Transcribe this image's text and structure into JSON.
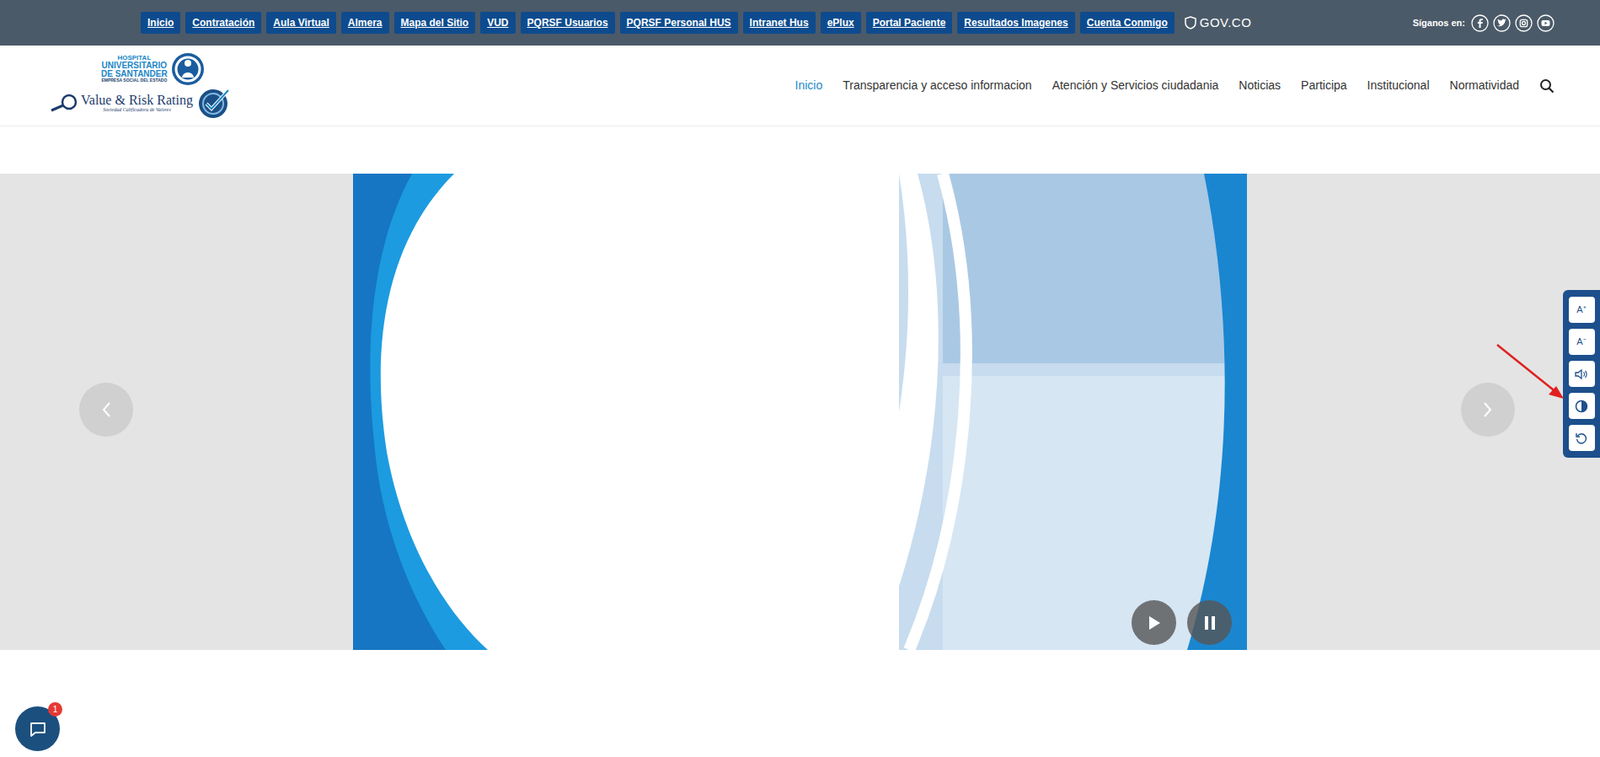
{
  "top_links": [
    "Inicio",
    "Contratación",
    "Aula Virtual",
    "Almera",
    "Mapa del Sitio",
    "VUD",
    "PQRSF Usuarios",
    "PQRSF Personal HUS",
    "Intranet Hus",
    "ePlux",
    "Portal Paciente",
    "Resultados Imagenes",
    "Cuenta Conmigo"
  ],
  "gov_logo": "GOV.CO",
  "social": {
    "label": "Síganos en:"
  },
  "logo": {
    "line1": "HOSPITAL",
    "line2": "UNIVERSITARIO",
    "line3": "DE SANTANDER",
    "line4": "EMPRESA SOCIAL DEL ESTADO",
    "rating": "Value & Risk Rating",
    "rating_sub": "Sociedad Calificadora de Valores"
  },
  "nav": [
    {
      "label": "Inicio",
      "selected": true
    },
    {
      "label": "Transparencia y acceso informacion",
      "selected": false
    },
    {
      "label": "Atención y Servicios ciudadania",
      "selected": false
    },
    {
      "label": "Noticias",
      "selected": false
    },
    {
      "label": "Participa",
      "selected": false
    },
    {
      "label": "Institucional",
      "selected": false
    },
    {
      "label": "Normatividad",
      "selected": false
    }
  ],
  "accessibility": {
    "increase": "A⁺",
    "decrease": "A⁻"
  },
  "chat": {
    "badge": "1"
  }
}
